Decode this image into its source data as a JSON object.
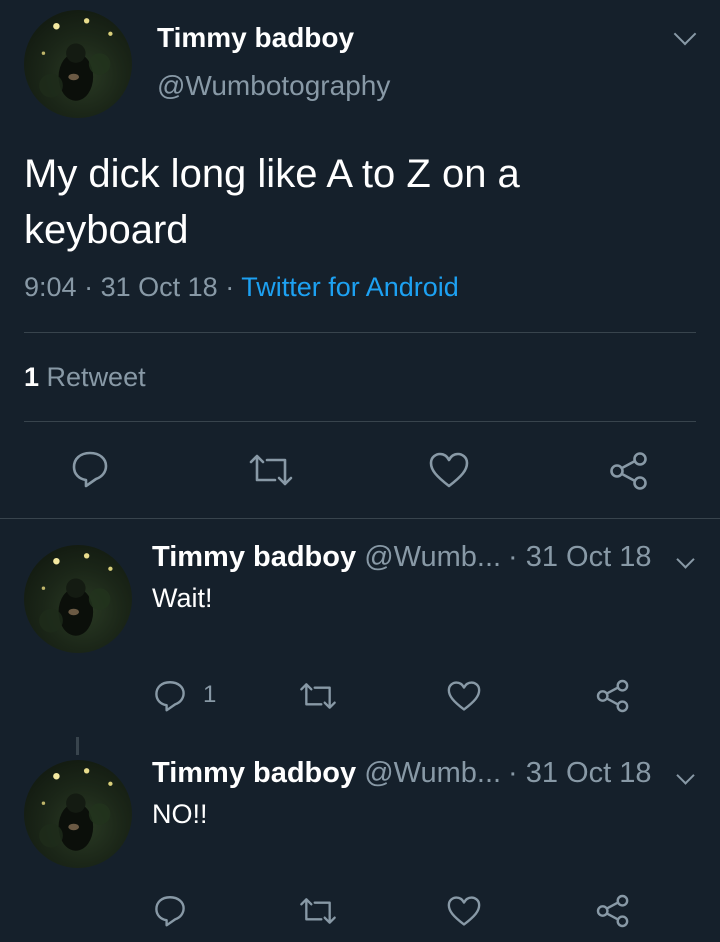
{
  "main_tweet": {
    "author_name": "Timmy badboy",
    "handle": "@Wumbotography",
    "text": "My dick long like A to Z on a keyboard",
    "time": "9:04",
    "date": "31 Oct 18",
    "separator": "·",
    "source": "Twitter for Android",
    "retweet_count": "1",
    "retweet_label": "Retweet",
    "actions": [
      "reply-icon",
      "retweet-icon",
      "like-icon",
      "share-icon"
    ]
  },
  "replies": [
    {
      "author_name": "Timmy badboy",
      "handle": "@Wumb...",
      "date": "· 31 Oct 18",
      "text": "Wait!",
      "reply_count": "1"
    },
    {
      "author_name": "Timmy badboy",
      "handle": "@Wumb...",
      "date": "· 31 Oct 18",
      "text": "NO!!",
      "reply_count": ""
    }
  ],
  "colors": {
    "background": "#15202b",
    "secondary_text": "#8899a6",
    "accent": "#1da1f2",
    "divider": "#38444d"
  }
}
